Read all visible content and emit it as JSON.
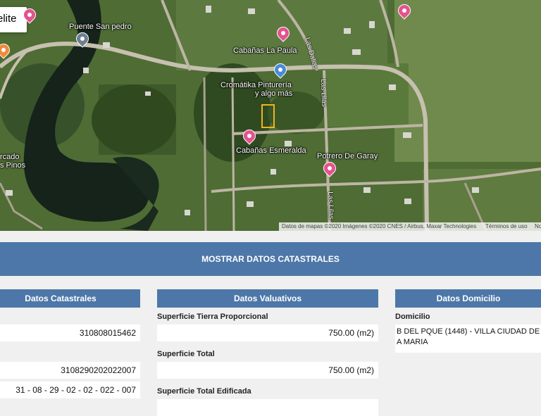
{
  "map": {
    "map_type_label": "elite",
    "places": {
      "puente": "Puente San pedro",
      "cabanas_paula": "Cabañas La Paula",
      "cromatika_1": "Cromátika Pinturería",
      "cromatika_2": "y algo más",
      "esmeralda": "Cabañas Esmeralda",
      "potrero": "Potrero De Garay",
      "mercado_1": "rcado",
      "mercado_2": "s Pinos"
    },
    "streets": {
      "dalias": "Las Dalias",
      "lilas_1": "Las Lilas",
      "lilas_2": "Las Lilas"
    },
    "attribution": "Datos de mapas ©2020 Imágenes ©2020 CNES / Airbus, Maxar Technologies",
    "terms": "Términos de uso",
    "report": "No"
  },
  "button": {
    "label": "MOSTRAR DATOS CATASTRALES"
  },
  "sections": {
    "catastrales": {
      "title": "Datos Catastrales",
      "values": [
        "310808015462",
        "3108290202022007",
        "31 - 08 - 29 - 02 - 02 - 022 - 007"
      ]
    },
    "valuativos": {
      "title": "Datos Valuativos",
      "fields": [
        {
          "label": "Superficie Tierra Proporcional",
          "value": "750.00 (m2)"
        },
        {
          "label": "Superficie Total",
          "value": "750.00 (m2)"
        },
        {
          "label": "Superficie Total Edificada",
          "value": ""
        }
      ]
    },
    "domicilio": {
      "title": "Datos Domicilio",
      "label": "Domicilio",
      "value": "B DEL PQUE (1448) - VILLA CIUDAD DE A MARIA"
    }
  },
  "colors": {
    "header_blue": "#4d77a8",
    "pin_pink": "#e4538f",
    "pin_blue": "#4a8ad8",
    "pin_gray": "#6e7f93",
    "pin_orange": "#f08a3c"
  }
}
